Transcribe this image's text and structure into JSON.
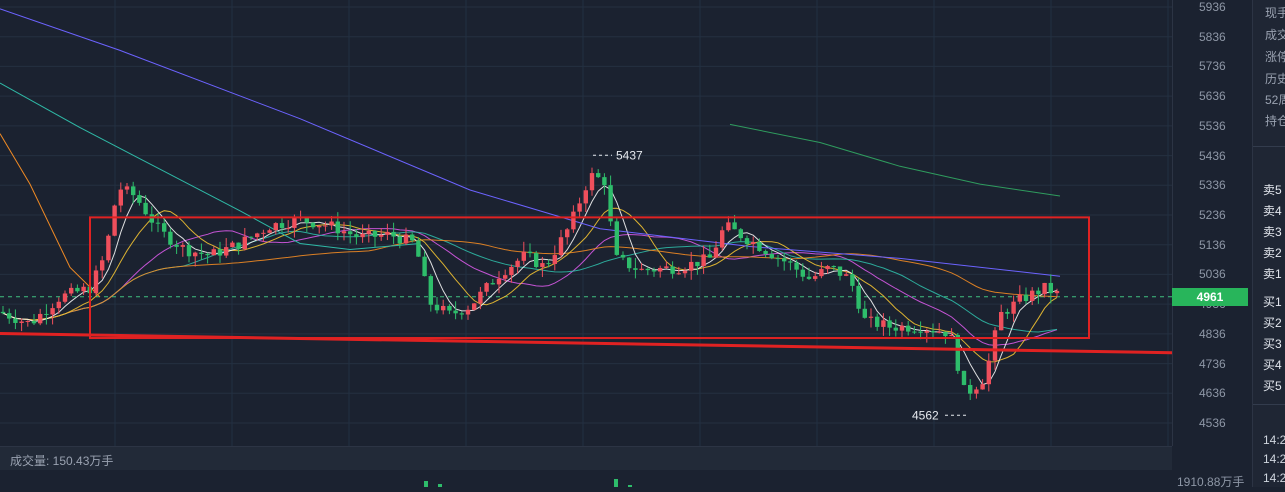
{
  "chart_data": {
    "type": "candlestick",
    "y_range": [
      4500,
      5960
    ],
    "y_ticks": [
      5936,
      5836,
      5736,
      5636,
      5536,
      5436,
      5336,
      5236,
      5136,
      5036,
      4936,
      4836,
      4736,
      4636,
      4536
    ],
    "current_price": 4961,
    "current_price_label": "4961",
    "annotations": {
      "high": {
        "value": 5437,
        "label": "5437"
      },
      "low": {
        "value": 4562,
        "label": "4562"
      }
    },
    "drawings": {
      "box": {
        "top": 5228,
        "bottom": 4822,
        "color": "#e02222"
      },
      "arrow": {
        "y_start": 4837,
        "y_end": 4770,
        "color": "#e02222"
      }
    },
    "colors": {
      "up": "#ef4f5c",
      "down": "#2ebd6b",
      "ma5": "#f4f4f4",
      "ma10": "#f1c232",
      "ma20": "#d659e6",
      "ma30": "#2fb9a6",
      "ma60": "#f08a24",
      "ma120": "#6c63ff",
      "ma250": "#2f9c5e"
    },
    "volume_label": "成交量: 150.43万手",
    "volume_axis_label": "1910.88万手"
  },
  "side_panel": {
    "info_items": [
      "现手",
      "成交",
      "涨停",
      "历史",
      "52周",
      "持仓"
    ],
    "sell_levels": [
      "卖5",
      "卖4",
      "卖3",
      "卖2",
      "卖1"
    ],
    "buy_levels": [
      "买1",
      "买2",
      "买3",
      "买4",
      "买5"
    ],
    "times": [
      "14:2",
      "14:2",
      "14:2"
    ]
  }
}
